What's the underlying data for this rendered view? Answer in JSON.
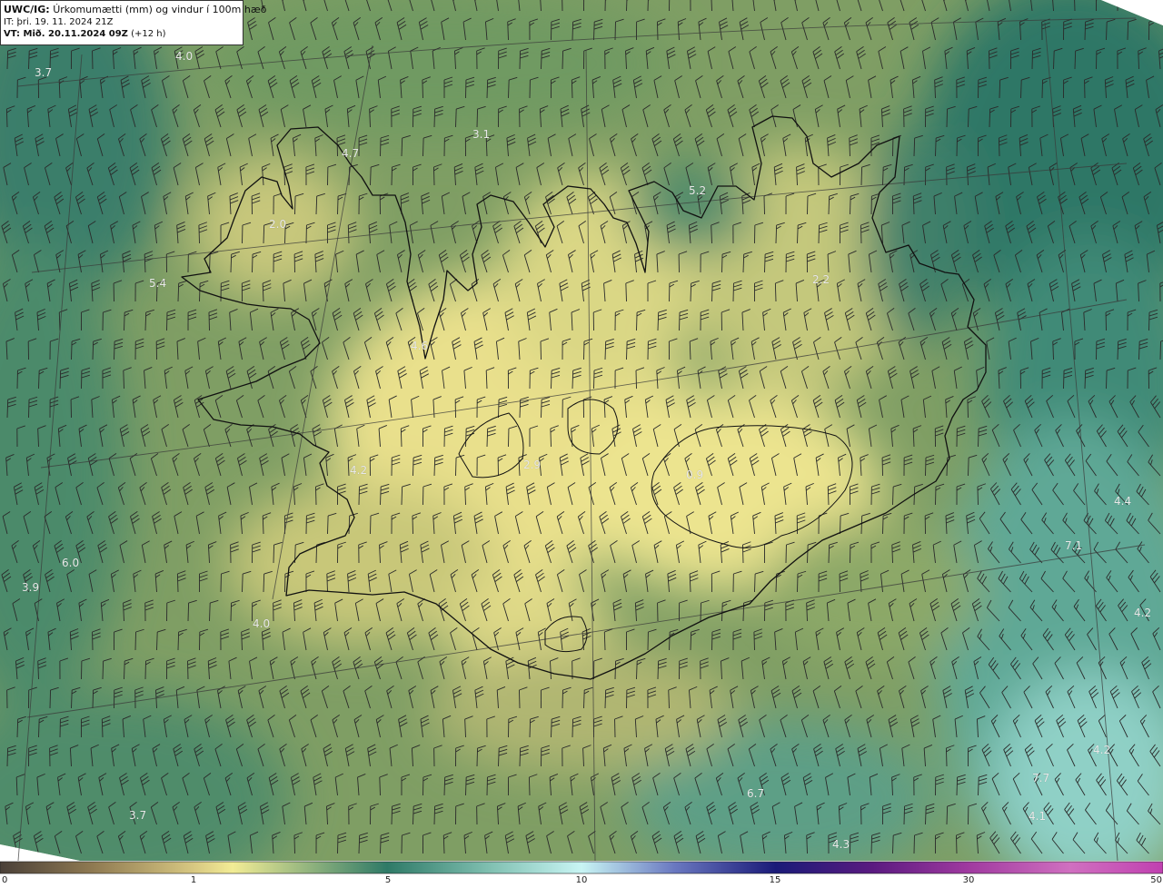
{
  "header": {
    "product": "UWC/IG:",
    "title": "Úrkomumætti (mm) og vindur í 100m hæð",
    "init_time": "IT: þri. 19. 11. 2024 21Z",
    "valid_label": "VT: Mið. 20.11.2024 09Z",
    "valid_offset": "(+12 h)"
  },
  "colorbar": {
    "ticks": [
      "0",
      "1",
      "5",
      "10",
      "15",
      "30",
      "50"
    ],
    "colors": [
      "#4a4038",
      "#b8a470",
      "#f2ec95",
      "#2f7a67",
      "#c8f5f4",
      "#1a1a78",
      "#7a1a7a",
      "#c040b0"
    ]
  },
  "map": {
    "value_labels": [
      "3.7",
      "4.0",
      "3.1",
      "4.7",
      "5.2",
      "2.0",
      "5.4",
      "2.2",
      "4.6",
      "4.2",
      "2.9",
      "0.9",
      "6.0",
      "3.9",
      "4.0",
      "4.4",
      "7.1",
      "4.2",
      "4.2",
      "7.7",
      "6.7",
      "3.7",
      "4.1",
      "4.3"
    ],
    "colors": {
      "field_low": "#f0e690",
      "field_mid": "#8fa565",
      "field_high": "#2e7766",
      "field_peak": "#8fd2cc",
      "coastline": "#111111",
      "barb": "#2a2a2a",
      "grid": "#3a3a3a"
    }
  }
}
